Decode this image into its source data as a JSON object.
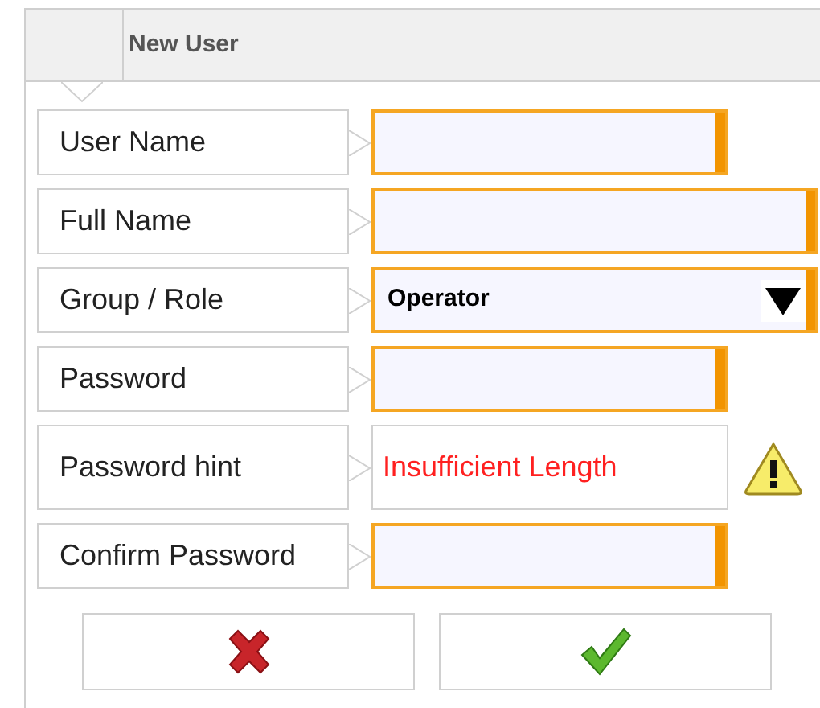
{
  "header": {
    "title": "New User"
  },
  "fields": [
    {
      "label": "User Name",
      "kind": "text",
      "wide": false,
      "required": true
    },
    {
      "label": "Full Name",
      "kind": "text",
      "wide": true,
      "required": true
    },
    {
      "label": "Group / Role",
      "kind": "select",
      "wide": true,
      "required": true,
      "value": "Operator"
    },
    {
      "label": "Password",
      "kind": "text",
      "wide": false,
      "required": true
    },
    {
      "label": "Password hint",
      "kind": "message",
      "wide": false,
      "required": false,
      "value": "Insufficient Length",
      "warning": true
    },
    {
      "label": "Confirm Password",
      "kind": "text",
      "wide": false,
      "required": true
    }
  ],
  "buttons": [
    {
      "kind": "cancel"
    },
    {
      "kind": "confirm"
    }
  ]
}
